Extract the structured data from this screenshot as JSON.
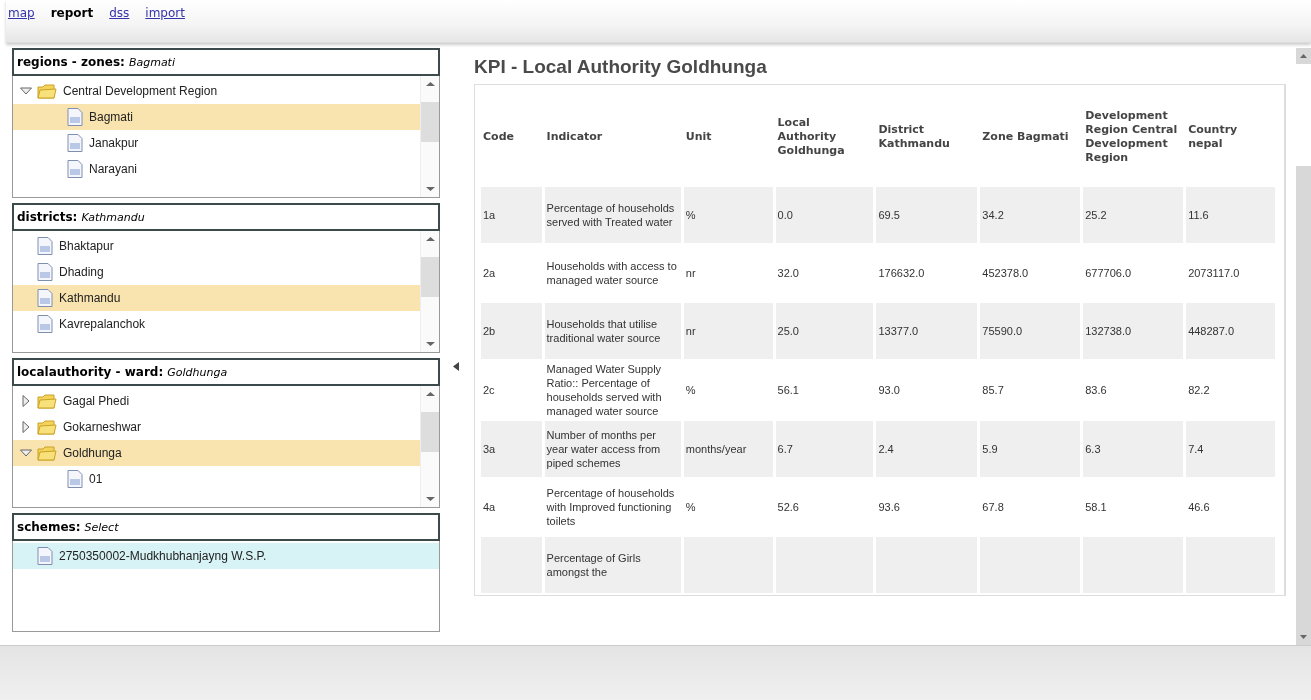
{
  "nav": [
    {
      "label": "map",
      "selected": false
    },
    {
      "label": "report",
      "selected": true
    },
    {
      "label": "dss",
      "selected": false
    },
    {
      "label": "import",
      "selected": false
    }
  ],
  "panels": [
    {
      "label": "regions - zones:",
      "value": "Bagmati",
      "items": [
        {
          "kind": "folder",
          "label": "Central Development Region",
          "expanded": true,
          "selected": false,
          "children": [
            {
              "kind": "leaf",
              "label": "Bagmati",
              "selected": true
            },
            {
              "kind": "leaf",
              "label": "Janakpur",
              "selected": false
            },
            {
              "kind": "leaf",
              "label": "Narayani",
              "selected": false
            }
          ]
        }
      ]
    },
    {
      "label": "districts:",
      "value": "Kathmandu",
      "items": [
        {
          "kind": "leaf",
          "label": "Bhaktapur",
          "selected": false
        },
        {
          "kind": "leaf",
          "label": "Dhading",
          "selected": false
        },
        {
          "kind": "leaf",
          "label": "Kathmandu",
          "selected": true
        },
        {
          "kind": "leaf",
          "label": "Kavrepalanchok",
          "selected": false
        }
      ]
    },
    {
      "label": "localauthority - ward:",
      "value": "Goldhunga",
      "items": [
        {
          "kind": "folder",
          "label": "Gagal Phedi",
          "expanded": false,
          "selected": false
        },
        {
          "kind": "folder",
          "label": "Gokarneshwar",
          "expanded": false,
          "selected": false
        },
        {
          "kind": "folder",
          "label": "Goldhunga",
          "expanded": true,
          "selected": true,
          "children": [
            {
              "kind": "leaf",
              "label": "01",
              "selected": false
            }
          ]
        }
      ]
    },
    {
      "label": "schemes:",
      "value": "Select",
      "items": [
        {
          "kind": "leaf",
          "label": "2750350002-Mudkhubhanjayng W.S.P.",
          "selected": false,
          "hovered": true
        }
      ]
    }
  ],
  "report": {
    "title": "KPI - Local Authority Goldhunga",
    "columns": [
      "Code",
      "Indicator",
      "Unit",
      "Local Authority Goldhunga",
      "District Kathmandu",
      "Zone Bagmati",
      "Development Region Central Development Region",
      "Country nepal"
    ],
    "rows": [
      [
        "1a",
        "Percentage of households served with Treated water",
        "%",
        "0.0",
        "69.5",
        "34.2",
        "25.2",
        "11.6"
      ],
      [
        "2a",
        "Households with access to managed water source",
        "nr",
        "32.0",
        "176632.0",
        "452378.0",
        "677706.0",
        "2073117.0"
      ],
      [
        "2b",
        "Households that utilise traditional water source",
        "nr",
        "25.0",
        "13377.0",
        "75590.0",
        "132738.0",
        "448287.0"
      ],
      [
        "2c",
        "Managed Water Supply Ratio:: Percentage of households served with managed water source",
        "%",
        "56.1",
        "93.0",
        "85.7",
        "83.6",
        "82.2"
      ],
      [
        "3a",
        "Number of months per year water access from piped schemes",
        "months/year",
        "6.7",
        "2.4",
        "5.9",
        "6.3",
        "7.4"
      ],
      [
        "4a",
        "Percentage of households with Improved functioning toilets",
        "%",
        "52.6",
        "93.6",
        "67.8",
        "58.1",
        "46.6"
      ],
      [
        "",
        "Percentage of Girls amongst the",
        "",
        "",
        "",
        "",
        "",
        ""
      ]
    ]
  }
}
